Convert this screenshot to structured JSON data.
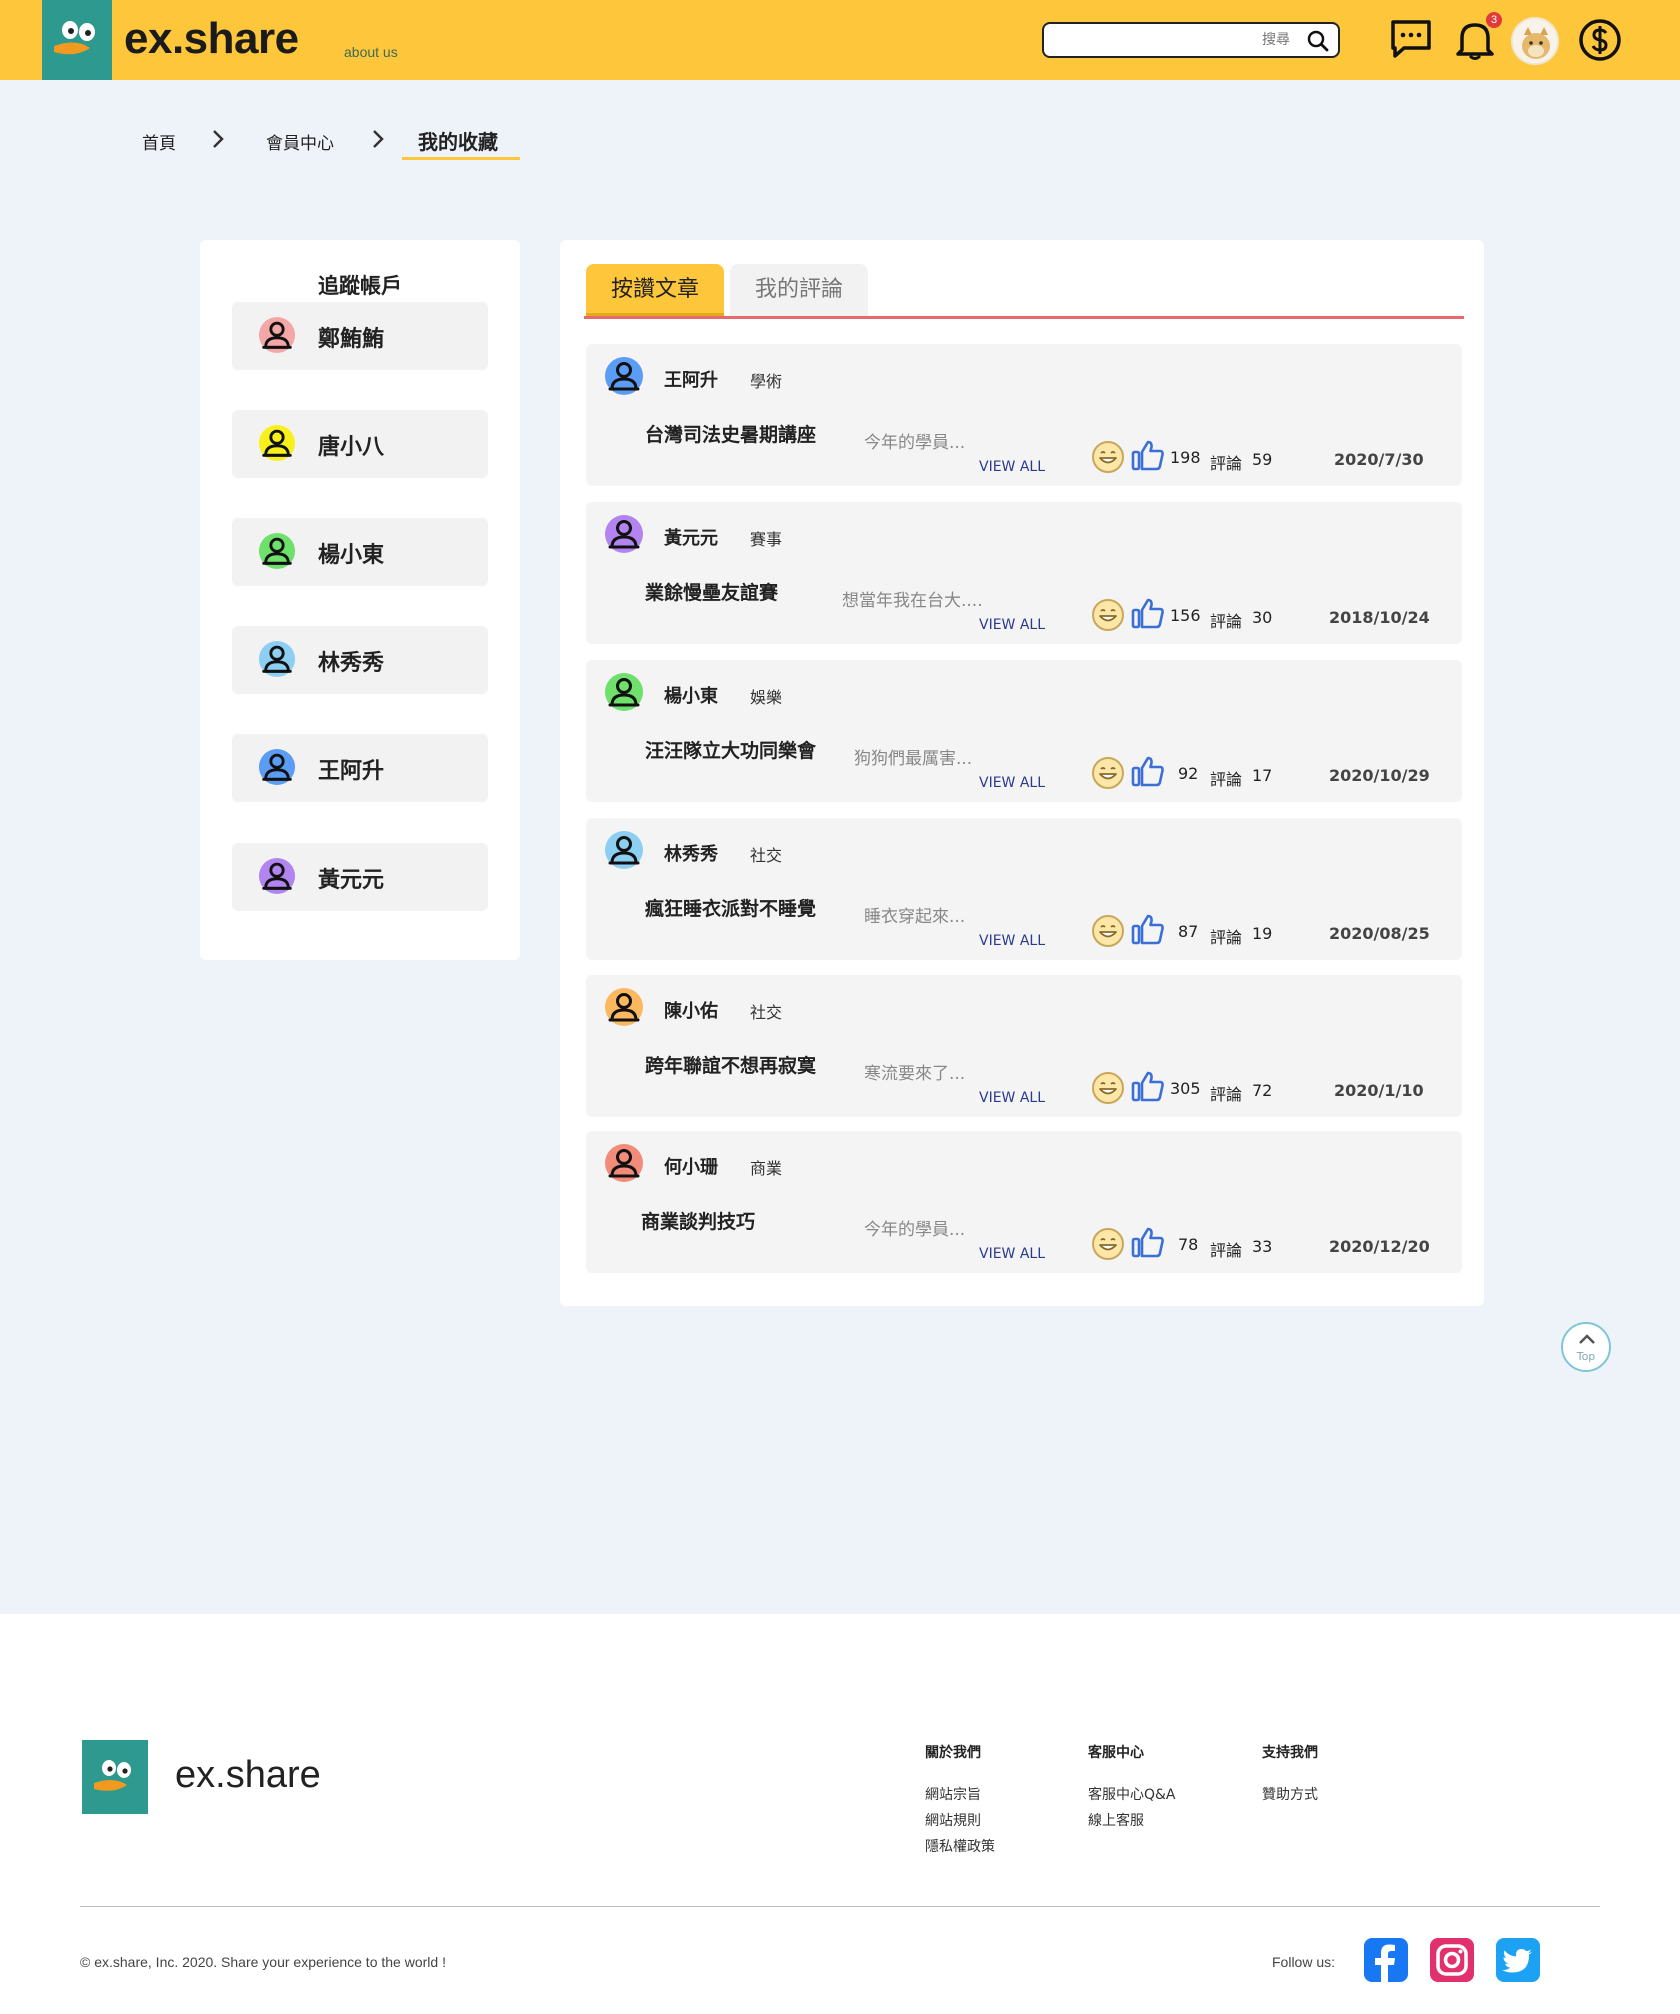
{
  "header": {
    "brand": "ex.share",
    "about": "about us",
    "search_placeholder": "搜尋",
    "notification_count": "3",
    "colors": {
      "bar": "#fec63a",
      "brand_box": "#2e9a8f"
    }
  },
  "breadcrumb": {
    "items": [
      "首頁",
      "會員中心",
      "我的收藏"
    ]
  },
  "sidebar": {
    "title": "追蹤帳戶",
    "accounts": [
      {
        "name": "鄭鮪鮪",
        "color": "#f3a7a7"
      },
      {
        "name": "唐小八",
        "color": "#f7f01d"
      },
      {
        "name": "楊小東",
        "color": "#6ee06b"
      },
      {
        "name": "林秀秀",
        "color": "#8ccff2"
      },
      {
        "name": "王阿升",
        "color": "#5b9cf5"
      },
      {
        "name": "黃元元",
        "color": "#b184f0"
      }
    ]
  },
  "tabs": [
    {
      "label": "按讚文章",
      "active": true
    },
    {
      "label": "我的評論",
      "active": false
    }
  ],
  "posts": [
    {
      "author": "王阿升",
      "category": "學術",
      "title": "台灣司法史暑期講座",
      "excerpt": "今年的學員...",
      "view_all": "VIEW ALL",
      "likes": "198",
      "comment_label": "評論",
      "comments": "59",
      "date": "2020/7/30",
      "color": "#5b9cf5"
    },
    {
      "author": "黃元元",
      "category": "賽事",
      "title": "業餘慢壘友誼賽",
      "excerpt": "想當年我在台大....",
      "view_all": "VIEW ALL",
      "likes": "156",
      "comment_label": "評論",
      "comments": "30",
      "date": "2018/10/24",
      "color": "#b184f0"
    },
    {
      "author": "楊小東",
      "category": "娛樂",
      "title": "汪汪隊立大功同樂會",
      "excerpt": "狗狗們最厲害...",
      "view_all": "VIEW ALL",
      "likes": "92",
      "comment_label": "評論",
      "comments": "17",
      "date": "2020/10/29",
      "color": "#6ee06b"
    },
    {
      "author": "林秀秀",
      "category": "社交",
      "title": "瘋狂睡衣派對不睡覺",
      "excerpt": "睡衣穿起來...",
      "view_all": "VIEW ALL",
      "likes": "87",
      "comment_label": "評論",
      "comments": "19",
      "date": "2020/08/25",
      "color": "#8ccff2"
    },
    {
      "author": "陳小佑",
      "category": "社交",
      "title": "跨年聯誼不想再寂寞",
      "excerpt": "寒流要來了...",
      "view_all": "VIEW ALL",
      "likes": "305",
      "comment_label": "評論",
      "comments": "72",
      "date": "2020/1/10",
      "color": "#fbb860"
    },
    {
      "author": "何小珊",
      "category": "商業",
      "title": "商業談判技巧",
      "excerpt": "今年的學員...",
      "view_all": "VIEW ALL",
      "likes": "78",
      "comment_label": "評論",
      "comments": "33",
      "date": "2020/12/20",
      "color": "#f28b7a"
    }
  ],
  "top_button": "Top",
  "footer": {
    "brand": "ex.share",
    "columns": [
      {
        "heading": "關於我們",
        "items": [
          "網站宗旨",
          "網站規則",
          "隱私權政策"
        ]
      },
      {
        "heading": "客服中心",
        "items": [
          "客服中心Q&A",
          "線上客服"
        ]
      },
      {
        "heading": "支持我們",
        "items": [
          "贊助方式"
        ]
      }
    ],
    "copyright": "© ex.share, Inc. 2020. Share your experience to the world !",
    "follow_us": "Follow us:",
    "social": [
      "facebook-icon",
      "instagram-icon",
      "twitter-icon"
    ]
  }
}
